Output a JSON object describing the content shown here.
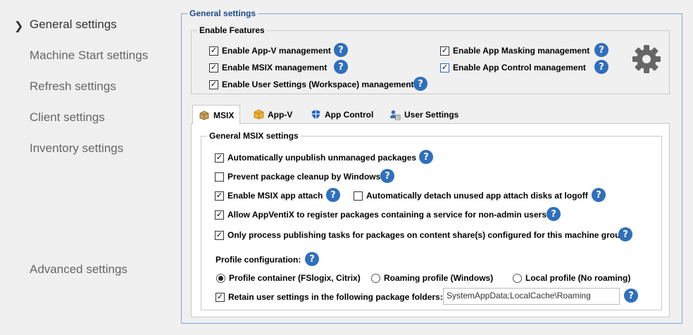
{
  "sidebar": {
    "items": [
      {
        "label": "General settings"
      },
      {
        "label": "Machine Start settings"
      },
      {
        "label": "Refresh settings"
      },
      {
        "label": "Client settings"
      },
      {
        "label": "Inventory settings"
      },
      {
        "label": "Advanced settings"
      }
    ],
    "active_index": 0
  },
  "general": {
    "title": "General settings",
    "features": {
      "title": "Enable Features",
      "items": [
        {
          "label": "Enable App-V management",
          "checked": true
        },
        {
          "label": "Enable MSIX management",
          "checked": true
        },
        {
          "label": "Enable User Settings (Workspace) management",
          "checked": true
        },
        {
          "label": "Enable App Masking management",
          "checked": true
        },
        {
          "label": "Enable App Control management",
          "checked": true
        }
      ]
    },
    "tabs": [
      {
        "label": "MSIX",
        "icon": "package-icon",
        "active": true
      },
      {
        "label": "App-V",
        "icon": "box-icon",
        "active": false
      },
      {
        "label": "App Control",
        "icon": "shield-icon",
        "active": false
      },
      {
        "label": "User Settings",
        "icon": "user-settings-icon",
        "active": false
      }
    ],
    "msix": {
      "title": "General MSIX settings",
      "options": [
        {
          "label": "Automatically unpublish unmanaged packages",
          "checked": true
        },
        {
          "label": "Prevent package cleanup by Windows",
          "checked": false
        },
        {
          "label": "Enable MSIX app attach",
          "checked": true
        },
        {
          "label": "Automatically detach unused app attach disks at logoff",
          "checked": false
        },
        {
          "label": "Allow AppVentiX to register packages containing a service for non-admin users",
          "checked": true
        },
        {
          "label": "Only process publishing tasks for packages on content share(s) configured for this machine group",
          "checked": true
        }
      ],
      "profile_label": "Profile configuration:",
      "profile_options": [
        {
          "label": "Profile container (FSlogix, Citrix)",
          "selected": true
        },
        {
          "label": "Roaming profile (Windows)",
          "selected": false
        },
        {
          "label": "Local profile (No roaming)",
          "selected": false
        }
      ],
      "retain": {
        "label": "Retain user settings in the following package folders:",
        "checked": true,
        "value": "SystemAppData;LocalCache\\Roaming"
      }
    },
    "help_glyph": "?"
  },
  "colors": {
    "help": "#2f6fbd",
    "outer_border": "#7fa7d3",
    "title": "#1f4a8c",
    "sidebar_bg": "#efefef"
  }
}
